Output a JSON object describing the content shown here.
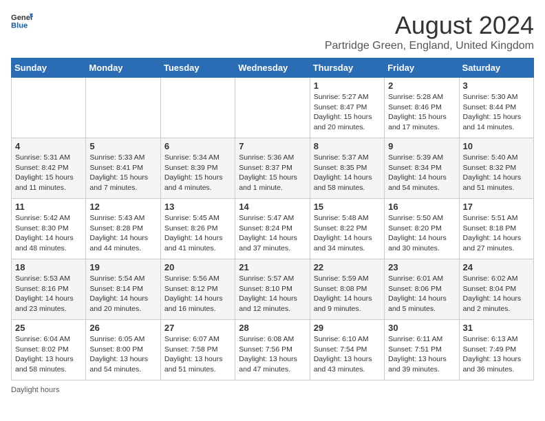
{
  "header": {
    "logo_general": "General",
    "logo_blue": "Blue",
    "month_title": "August 2024",
    "location": "Partridge Green, England, United Kingdom"
  },
  "weekdays": [
    "Sunday",
    "Monday",
    "Tuesday",
    "Wednesday",
    "Thursday",
    "Friday",
    "Saturday"
  ],
  "weeks": [
    [
      null,
      null,
      null,
      null,
      {
        "day": 1,
        "sunrise": "5:27 AM",
        "sunset": "8:47 PM",
        "daylight": "15 hours and 20 minutes."
      },
      {
        "day": 2,
        "sunrise": "5:28 AM",
        "sunset": "8:46 PM",
        "daylight": "15 hours and 17 minutes."
      },
      {
        "day": 3,
        "sunrise": "5:30 AM",
        "sunset": "8:44 PM",
        "daylight": "15 hours and 14 minutes."
      }
    ],
    [
      {
        "day": 4,
        "sunrise": "5:31 AM",
        "sunset": "8:42 PM",
        "daylight": "15 hours and 11 minutes."
      },
      {
        "day": 5,
        "sunrise": "5:33 AM",
        "sunset": "8:41 PM",
        "daylight": "15 hours and 7 minutes."
      },
      {
        "day": 6,
        "sunrise": "5:34 AM",
        "sunset": "8:39 PM",
        "daylight": "15 hours and 4 minutes."
      },
      {
        "day": 7,
        "sunrise": "5:36 AM",
        "sunset": "8:37 PM",
        "daylight": "15 hours and 1 minute."
      },
      {
        "day": 8,
        "sunrise": "5:37 AM",
        "sunset": "8:35 PM",
        "daylight": "14 hours and 58 minutes."
      },
      {
        "day": 9,
        "sunrise": "5:39 AM",
        "sunset": "8:34 PM",
        "daylight": "14 hours and 54 minutes."
      },
      {
        "day": 10,
        "sunrise": "5:40 AM",
        "sunset": "8:32 PM",
        "daylight": "14 hours and 51 minutes."
      }
    ],
    [
      {
        "day": 11,
        "sunrise": "5:42 AM",
        "sunset": "8:30 PM",
        "daylight": "14 hours and 48 minutes."
      },
      {
        "day": 12,
        "sunrise": "5:43 AM",
        "sunset": "8:28 PM",
        "daylight": "14 hours and 44 minutes."
      },
      {
        "day": 13,
        "sunrise": "5:45 AM",
        "sunset": "8:26 PM",
        "daylight": "14 hours and 41 minutes."
      },
      {
        "day": 14,
        "sunrise": "5:47 AM",
        "sunset": "8:24 PM",
        "daylight": "14 hours and 37 minutes."
      },
      {
        "day": 15,
        "sunrise": "5:48 AM",
        "sunset": "8:22 PM",
        "daylight": "14 hours and 34 minutes."
      },
      {
        "day": 16,
        "sunrise": "5:50 AM",
        "sunset": "8:20 PM",
        "daylight": "14 hours and 30 minutes."
      },
      {
        "day": 17,
        "sunrise": "5:51 AM",
        "sunset": "8:18 PM",
        "daylight": "14 hours and 27 minutes."
      }
    ],
    [
      {
        "day": 18,
        "sunrise": "5:53 AM",
        "sunset": "8:16 PM",
        "daylight": "14 hours and 23 minutes."
      },
      {
        "day": 19,
        "sunrise": "5:54 AM",
        "sunset": "8:14 PM",
        "daylight": "14 hours and 20 minutes."
      },
      {
        "day": 20,
        "sunrise": "5:56 AM",
        "sunset": "8:12 PM",
        "daylight": "14 hours and 16 minutes."
      },
      {
        "day": 21,
        "sunrise": "5:57 AM",
        "sunset": "8:10 PM",
        "daylight": "14 hours and 12 minutes."
      },
      {
        "day": 22,
        "sunrise": "5:59 AM",
        "sunset": "8:08 PM",
        "daylight": "14 hours and 9 minutes."
      },
      {
        "day": 23,
        "sunrise": "6:01 AM",
        "sunset": "8:06 PM",
        "daylight": "14 hours and 5 minutes."
      },
      {
        "day": 24,
        "sunrise": "6:02 AM",
        "sunset": "8:04 PM",
        "daylight": "14 hours and 2 minutes."
      }
    ],
    [
      {
        "day": 25,
        "sunrise": "6:04 AM",
        "sunset": "8:02 PM",
        "daylight": "13 hours and 58 minutes."
      },
      {
        "day": 26,
        "sunrise": "6:05 AM",
        "sunset": "8:00 PM",
        "daylight": "13 hours and 54 minutes."
      },
      {
        "day": 27,
        "sunrise": "6:07 AM",
        "sunset": "7:58 PM",
        "daylight": "13 hours and 51 minutes."
      },
      {
        "day": 28,
        "sunrise": "6:08 AM",
        "sunset": "7:56 PM",
        "daylight": "13 hours and 47 minutes."
      },
      {
        "day": 29,
        "sunrise": "6:10 AM",
        "sunset": "7:54 PM",
        "daylight": "13 hours and 43 minutes."
      },
      {
        "day": 30,
        "sunrise": "6:11 AM",
        "sunset": "7:51 PM",
        "daylight": "13 hours and 39 minutes."
      },
      {
        "day": 31,
        "sunrise": "6:13 AM",
        "sunset": "7:49 PM",
        "daylight": "13 hours and 36 minutes."
      }
    ]
  ],
  "footer": {
    "daylight_label": "Daylight hours"
  }
}
